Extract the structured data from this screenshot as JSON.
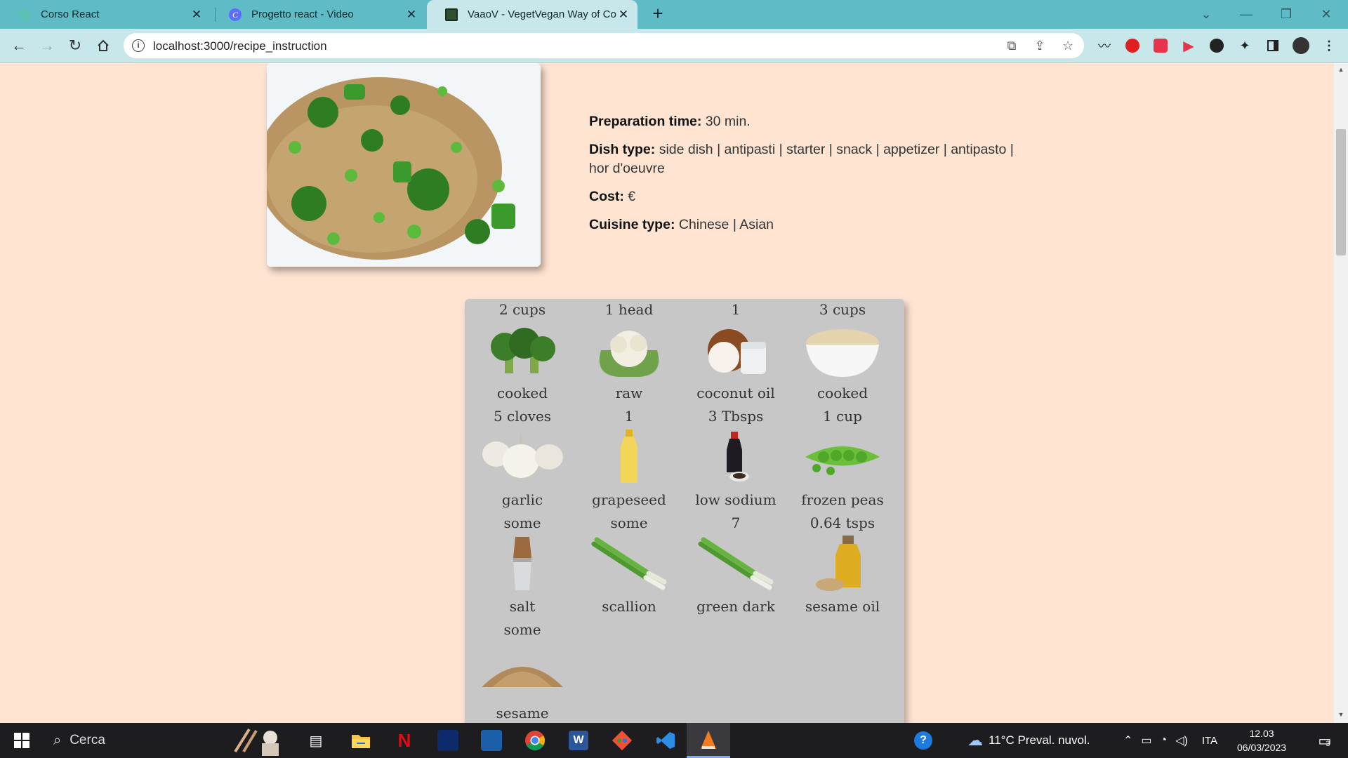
{
  "browser": {
    "tabs": [
      {
        "title": "Corso React",
        "favicon": "react-icon",
        "color": "#59c4a8"
      },
      {
        "title": "Progetto react - Video",
        "favicon": "canva-icon",
        "color": "#5b6cff"
      },
      {
        "title": "VaaoV - VegetVegan Way of Coo",
        "favicon": "vaaov-icon",
        "color": "#2f4f2f",
        "active": true
      }
    ],
    "new_tab": "+",
    "url": "localhost:3000/recipe_instruction"
  },
  "recipe": {
    "photo_alt": "fried rice with broccoli and peas",
    "prep_label": "Preparation time:",
    "prep_value": "30 min.",
    "dish_label": "Dish type:",
    "dish_value": "side dish | antipasti | starter | snack | appetizer | antipasto | hor d'oeuvre",
    "cost_label": "Cost:",
    "cost_value": "€",
    "cuisine_label": "Cuisine type:",
    "cuisine_value": "Chinese | Asian"
  },
  "ingredients": [
    {
      "qty": "2 cups",
      "name": "cooked",
      "icon": "broccoli-icon"
    },
    {
      "qty": "1 head",
      "name": "raw",
      "icon": "cauliflower-icon"
    },
    {
      "qty": "1",
      "name": "coconut oil",
      "icon": "coconut-icon"
    },
    {
      "qty": "3 cups",
      "name": "cooked",
      "icon": "rice-bowl-icon"
    },
    {
      "qty": "5 cloves",
      "name": "garlic",
      "icon": "garlic-icon"
    },
    {
      "qty": "1",
      "name": "grapeseed",
      "icon": "oil-bottle-icon"
    },
    {
      "qty": "3 Tbsps",
      "name": "low sodium",
      "icon": "soy-sauce-icon"
    },
    {
      "qty": "1 cup",
      "name": "frozen peas",
      "icon": "peas-icon"
    },
    {
      "qty": "some",
      "name": "salt",
      "icon": "salt-shaker-icon"
    },
    {
      "qty": "some",
      "name": "scallion",
      "icon": "scallion-icon"
    },
    {
      "qty": "7",
      "name": "green dark",
      "icon": "scallion-icon"
    },
    {
      "qty": "0.64 tsps",
      "name": "sesame oil",
      "icon": "sesame-oil-icon"
    },
    {
      "qty": "some",
      "name": "sesame",
      "icon": "sesame-seeds-icon"
    }
  ],
  "taskbar": {
    "search_placeholder": "Cerca",
    "weather": "11°C Preval. nuvol.",
    "language": "ITA",
    "time": "12.03",
    "date": "06/03/2023",
    "notifications": "3"
  }
}
